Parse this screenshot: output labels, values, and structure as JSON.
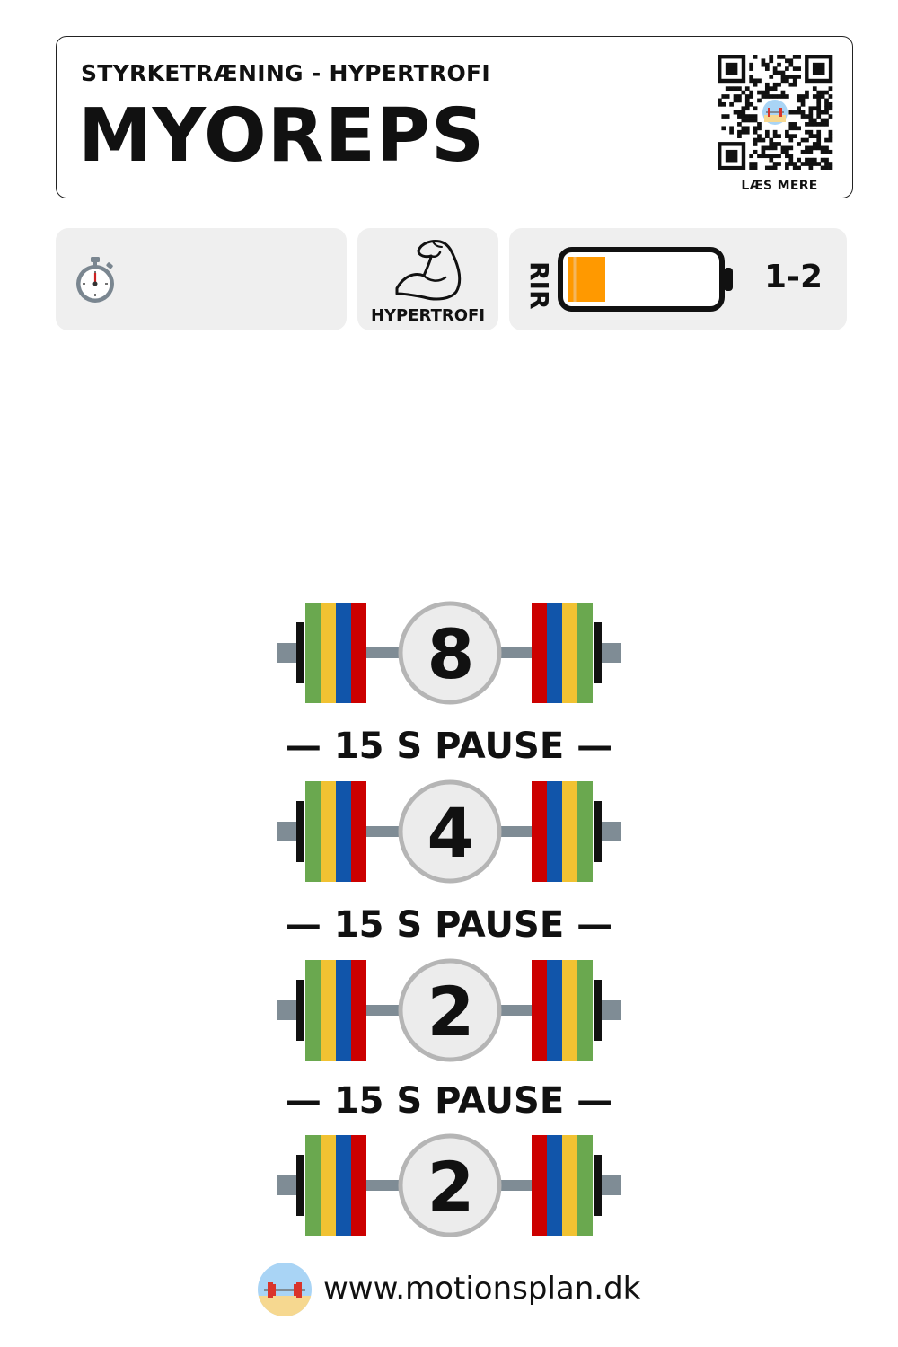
{
  "header": {
    "subtitle": "STYRKETRÆNING - HYPERTROFI",
    "title": "MYOREPS",
    "qr_caption": "LÆS MERE"
  },
  "info": {
    "timer_icon": "stopwatch-icon",
    "goal_icon": "flexed-arm-icon",
    "goal_label": "HYPERTROFI",
    "rir_label": "RIR",
    "rir_value": "1-2",
    "rir_battery_level": 0.25
  },
  "sets": [
    {
      "reps": "8"
    },
    {
      "reps": "4"
    },
    {
      "reps": "2"
    },
    {
      "reps": "2"
    }
  ],
  "pauses": [
    {
      "label": "— 15 S PAUSE —"
    },
    {
      "label": "— 15 S PAUSE —"
    },
    {
      "label": "— 15 S PAUSE —"
    }
  ],
  "footer": {
    "url": "www.motionsplan.dk",
    "logo_icon": "motionsplan-barbell-logo-icon"
  },
  "colors": {
    "plate_green": "#6aa84f",
    "plate_yellow": "#f1c232",
    "plate_blue": "#1155aa",
    "plate_red": "#cc0000",
    "bar_grey": "#7f8c95",
    "battery_orange": "#ff9900",
    "box_bg": "#efefef"
  }
}
